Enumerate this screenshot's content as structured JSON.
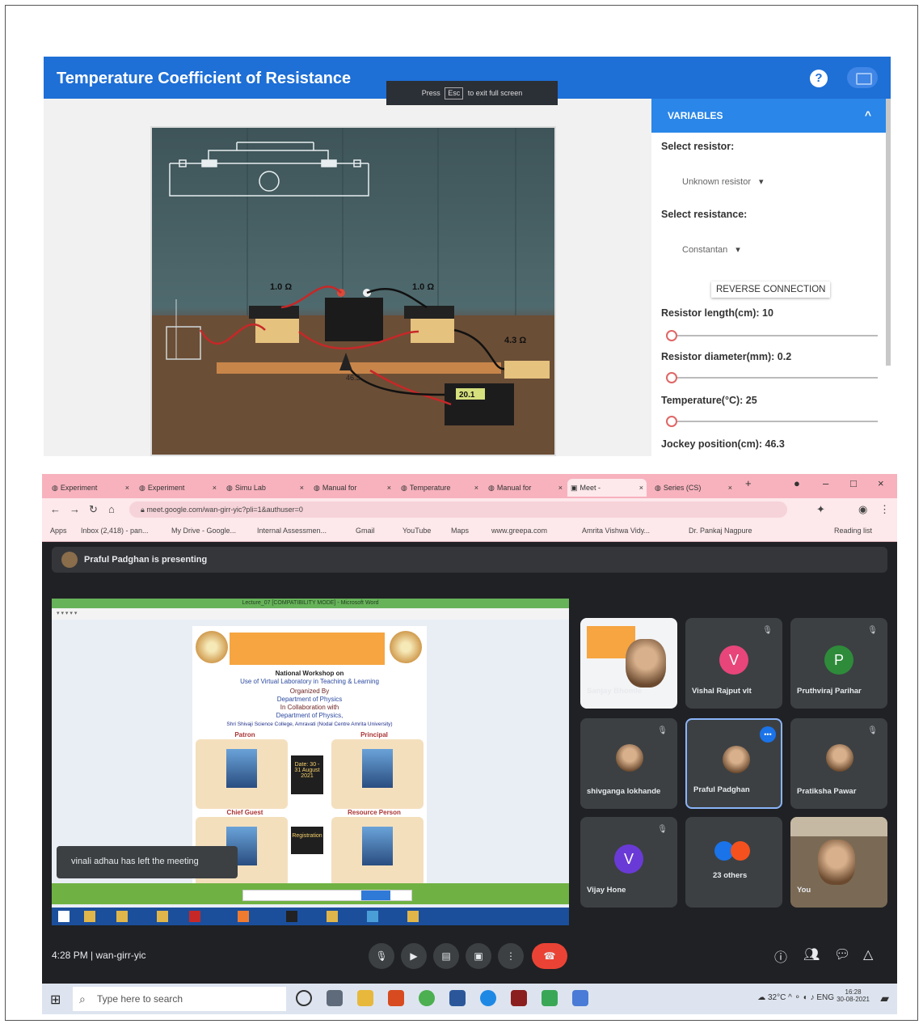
{
  "sim": {
    "title": "Temperature Coefficient of Resistance",
    "esc_before": "Press",
    "esc_key": "Esc",
    "esc_after": "to exit full screen",
    "panel_title": "VARIABLES",
    "select_resistor_label": "Select resistor:",
    "select_resistor_value": "Unknown resistor",
    "select_resistance_label": "Select resistance:",
    "select_resistance_value": "Constantan",
    "reverse_button": "REVERSE CONNECTION",
    "resistor_length_label": "Resistor length(cm): 10",
    "resistor_length_value": 10,
    "resistor_diameter_label": "Resistor diameter(mm): 0.2",
    "resistor_diameter_value": 0.2,
    "temperature_label": "Temperature(°C): 25",
    "temperature_value": 25,
    "jockey_label": "Jockey position(cm): 46.3",
    "canvas": {
      "box_left": "1.0 Ω",
      "box_right": "1.0 Ω",
      "box_far": "4.3 Ω",
      "meter_reading": "20.1",
      "jockey": "46.3"
    }
  },
  "browser": {
    "tabs": [
      "Experiment",
      "Experiment",
      "Simu Lab",
      "Manual for",
      "Temperature",
      "Manual for",
      "Meet -",
      "Series (CS)"
    ],
    "url": "meet.google.com/wan-girr-yic?pli=1&authuser=0",
    "bookmarks": [
      "Apps",
      "Inbox (2,418) - pan...",
      "My Drive - Google...",
      "Internal Assessmen...",
      "Gmail",
      "YouTube",
      "Maps",
      "www.greepa.com",
      "Amrita Vishwa Vidy...",
      "Dr. Pankaj Nagpure",
      "Reading list"
    ]
  },
  "meet": {
    "presenting_text": "Praful Padghan is presenting",
    "toast": "vinali adhau has left the meeting",
    "time": "4:28 PM",
    "meeting_code": "wan-girr-yic",
    "shared": {
      "window_title": "Lecture_07 [COMPATIBILITY MODE] - Microsoft Word",
      "poster_title": "National Workshop on",
      "poster_subtitle": "Use of Virtual Laboratory in Teaching & Learning",
      "organized_by": "Organized By",
      "department": "Department of Physics",
      "collab": "In Collaboration with",
      "department2": "Department of Physics,",
      "college": "Shri Shivaji Science College, Amravati (Nodal Centre Amrita University)",
      "patron": "Patron",
      "principal": "Principal",
      "date_label": "Date: 30 - 31 August 2021",
      "chief_guest": "Chief Guest",
      "resource_person": "Resource Person",
      "registration": "Registration"
    },
    "participants": [
      {
        "name": "Sanjay Bhomle",
        "initial": "",
        "color": ""
      },
      {
        "name": "Vishal Rajput vlt",
        "initial": "V",
        "color": "#e8457a"
      },
      {
        "name": "Pruthviraj Parihar",
        "initial": "P",
        "color": "#2e8b3a"
      },
      {
        "name": "shivganga lokhande",
        "initial": "",
        "color": ""
      },
      {
        "name": "Praful Padghan",
        "initial": "",
        "color": ""
      },
      {
        "name": "Pratiksha Pawar",
        "initial": "",
        "color": ""
      },
      {
        "name": "Vijay Hone",
        "initial": "V",
        "color": "#6a3ad6"
      },
      {
        "name": "23 others",
        "initial": "",
        "color": ""
      },
      {
        "name": "You",
        "initial": "",
        "color": ""
      }
    ]
  },
  "taskbar": {
    "search_placeholder": "Type here to search",
    "weather": "32°C",
    "time": "16:28",
    "date": "30-08-2021"
  }
}
